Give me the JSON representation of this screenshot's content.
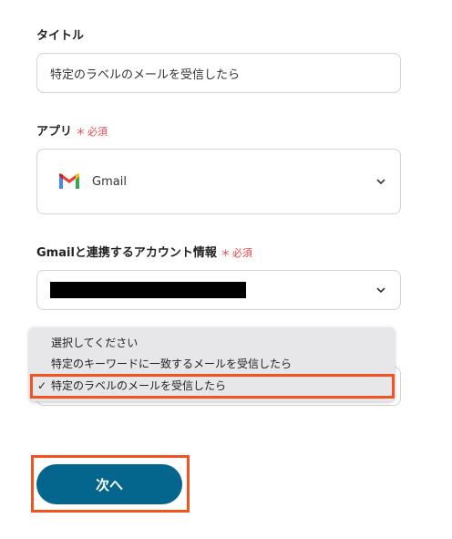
{
  "title_field": {
    "label": "タイトル",
    "value": "特定のラベルのメールを受信したら"
  },
  "app_field": {
    "label": "アプリ",
    "required_star": "＊",
    "required_text": "必須",
    "selected_app": "Gmail",
    "app_icon": "gmail-icon"
  },
  "account_field": {
    "label": "Gmailと連携するアカウント情報",
    "required_star": "＊",
    "required_text": "必須",
    "value_redacted": true
  },
  "trigger_dropdown": {
    "options": [
      "選択してください",
      "特定のキーワードに一致するメールを受信したら",
      "特定のラベルのメールを受信したら"
    ],
    "selected_index": 2,
    "check_mark": "✓"
  },
  "actions": {
    "next_label": "次へ"
  },
  "colors": {
    "primary_button": "#05668d",
    "required": "#e8454d",
    "highlight": "#f2531f",
    "dropdown_bg": "#e7e6e9"
  }
}
